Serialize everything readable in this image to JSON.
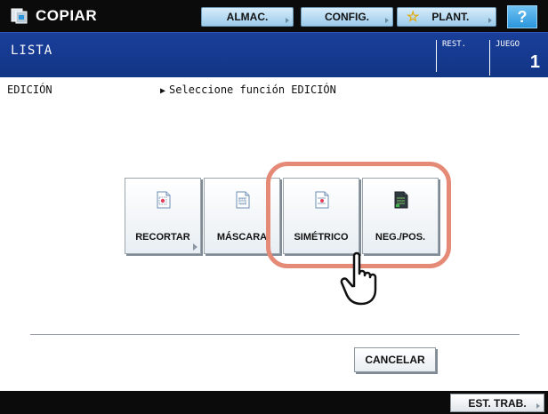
{
  "app": {
    "title": "COPIAR",
    "icon": "copier-icon"
  },
  "toolbar": {
    "almac_label": "ALMAC.",
    "config_label": "CONFIG.",
    "plant_label": "PLANT.",
    "help_label": "?"
  },
  "status": {
    "left_text": "LISTA",
    "rest_label": "REST.",
    "juego_label": "JUEGO",
    "juego_value": "1"
  },
  "main": {
    "section_label": "EDICIÓN",
    "instruction": "Seleccione función EDICIÓN",
    "functions": [
      {
        "label": "RECORTAR",
        "icon": "crop-document-icon"
      },
      {
        "label": "MÁSCARA",
        "icon": "mask-document-icon"
      },
      {
        "label": "SIMÉTRICO",
        "icon": "mirror-document-icon"
      },
      {
        "label": "NEG./POS.",
        "icon": "negative-positive-icon"
      }
    ],
    "cancel_label": "CANCELAR"
  },
  "footer": {
    "esttrab_label": "EST. TRAB."
  },
  "colors": {
    "topbar": "#0b0b0b",
    "statusbar": "#1a3f9a",
    "button_blue": "#9ccbea",
    "help_blue": "#2a95dc",
    "highlight": "#e58a77"
  }
}
